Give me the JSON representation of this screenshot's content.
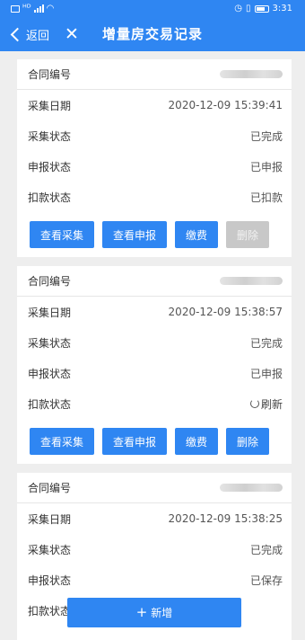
{
  "status_bar": {
    "time": "3:31",
    "signal": "ᴴᴰ"
  },
  "header": {
    "back_label": "返回",
    "close_symbol": "✕",
    "title": "增量房交易记录"
  },
  "labels": {
    "contract_no": "合同编号",
    "collect_date": "采集日期",
    "collect_status": "采集状态",
    "declare_status": "申报状态",
    "deduct_status": "扣款状态"
  },
  "records": [
    {
      "date": "2020-12-09 15:39:41",
      "collect_status": "已完成",
      "declare_status": "已申报",
      "deduct_status": "已扣款",
      "buttons": {
        "view_collect": "查看采集",
        "view_declare": "查看申报",
        "pay": "缴费",
        "delete": "删除"
      },
      "delete_enabled": false
    },
    {
      "date": "2020-12-09 15:38:57",
      "collect_status": "已完成",
      "declare_status": "已申报",
      "deduct_status": "刷新",
      "buttons": {
        "view_collect": "查看采集",
        "view_declare": "查看申报",
        "pay": "缴费",
        "delete": "删除"
      },
      "delete_enabled": true
    },
    {
      "date": "2020-12-09 15:38:25",
      "collect_status": "已完成",
      "declare_status": "已保存",
      "deduct_status": ""
    }
  ],
  "fab": {
    "icon": "plus-icon",
    "label": "新增"
  },
  "colors": {
    "primary": "#2f86f2",
    "background": "#eeeeee",
    "disabled": "#c8c8c8"
  }
}
